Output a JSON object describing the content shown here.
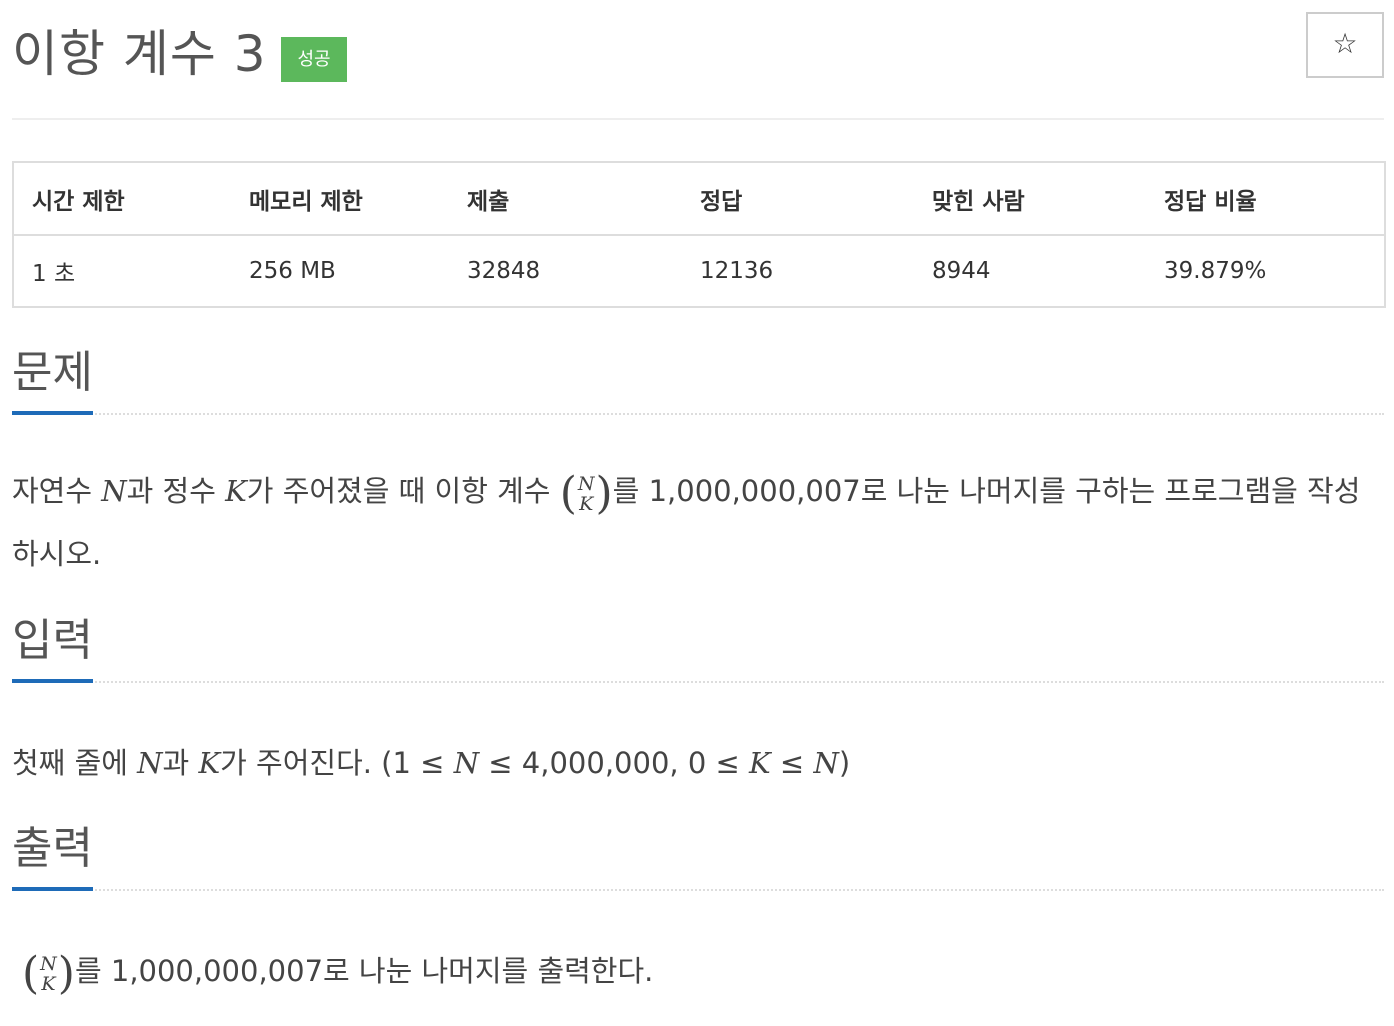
{
  "header": {
    "title": "이항 계수 3",
    "status_badge": "성공",
    "star_icon": "☆"
  },
  "info_table": {
    "headers": [
      "시간 제한",
      "메모리 제한",
      "제출",
      "정답",
      "맞힌 사람",
      "정답 비율"
    ],
    "values": [
      "1 초",
      "256 MB",
      "32848",
      "12136",
      "8944",
      "39.879%"
    ]
  },
  "sections": {
    "problem": {
      "title": "문제",
      "text_before_n": "자연수 ",
      "var_n": "N",
      "text_after_n": "과 정수 ",
      "var_k": "K",
      "text_after_k": "가 주어졌을 때 이항 계수 ",
      "binom_top": "N",
      "binom_bottom": "K",
      "text_after_binom": "를 1,000,000,007로 나눈 나머지를 구하는 프로그램을 작성하시오."
    },
    "input": {
      "title": "입력",
      "text_1": "첫째 줄에 ",
      "var_n": "N",
      "text_2": "과 ",
      "var_k": "K",
      "text_3": "가 주어진다. (1 ≤ ",
      "var_n2": "N",
      "text_4": " ≤ 4,000,000, 0 ≤ ",
      "var_k2": "K",
      "text_5": " ≤ ",
      "var_n3": "N",
      "text_6": ")"
    },
    "output": {
      "title": "출력",
      "binom_top": "N",
      "binom_bottom": "K",
      "text": "를 1,000,000,007로 나눈 나머지를 출력한다."
    }
  },
  "colors": {
    "badge_success": "#5cb85c",
    "section_underline": "#1e6bb8"
  }
}
